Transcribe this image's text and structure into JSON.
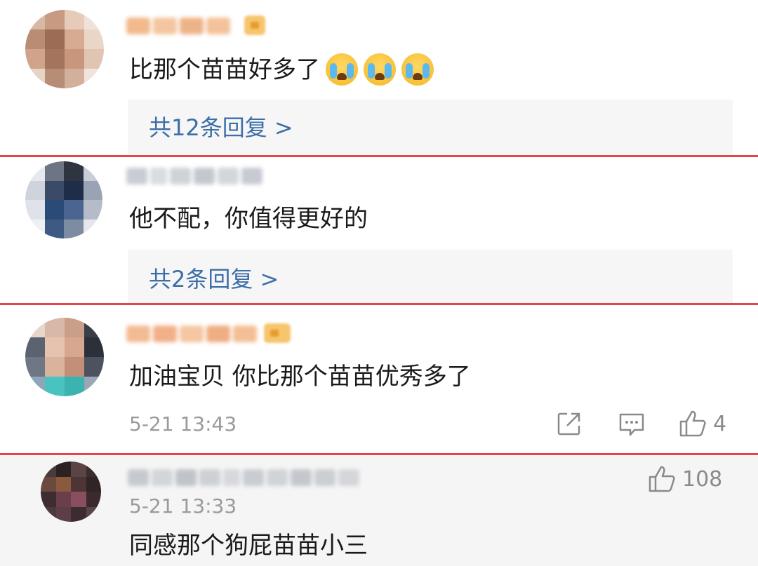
{
  "comments": [
    {
      "text": "比那个苗苗好多了",
      "emoji_icon": "crying-face-icon",
      "replies_label": "共12条回复 >"
    },
    {
      "text": "他不配，你值得更好的",
      "replies_label": "共2条回复 >"
    },
    {
      "text": "加油宝贝 你比那个苗苗优秀多了",
      "time": "5-21 13:43",
      "likes": "4"
    }
  ],
  "nested_reply": {
    "likes": "108",
    "time": "5-21 13:33",
    "text": "同感那个狗屁苗苗小三"
  },
  "colors": {
    "divider": "#e8424a",
    "link": "#3c6ea8",
    "meta": "#9a9a9a"
  }
}
